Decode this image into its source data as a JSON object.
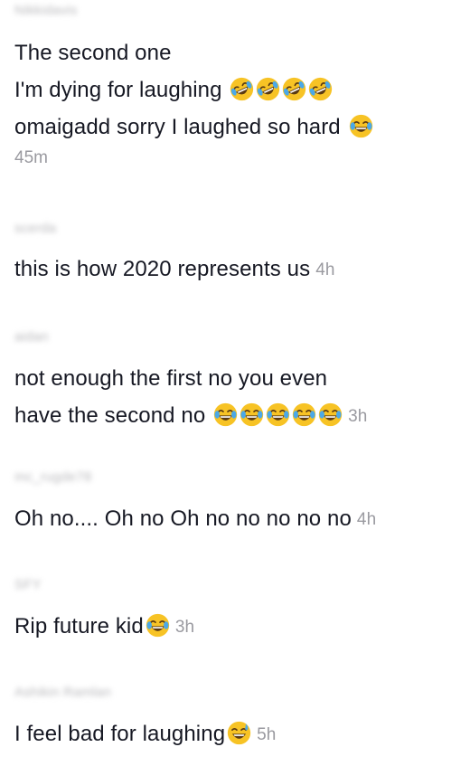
{
  "comments": [
    {
      "username": "Nikkidavis",
      "lines": [
        "The second one",
        "I'm dying for laughing",
        "omaigadd sorry I laughed so hard"
      ],
      "timestamp": "45m",
      "emoji": [
        "rolling-on-floor-laughing-icon",
        "face-with-tears-of-joy-icon"
      ]
    },
    {
      "username": "scerda",
      "lines": [
        "this is how 2020 represents us"
      ],
      "timestamp": "4h"
    },
    {
      "username": "aidan",
      "lines": [
        "not enough the first no you even",
        "have the second no"
      ],
      "timestamp": "3h",
      "emoji": [
        "face-with-tears-of-joy-icon"
      ]
    },
    {
      "username": "mc_rugde78",
      "lines": [
        "Oh no.... Oh no Oh no no no no no"
      ],
      "timestamp": "4h"
    },
    {
      "username": "SFY",
      "lines": [
        "Rip future kid"
      ],
      "timestamp": "3h",
      "emoji": [
        "face-with-tears-of-joy-icon"
      ]
    },
    {
      "username": "Ashikin Ramlan",
      "lines": [
        "I feel bad for laughing"
      ],
      "timestamp": "5h",
      "emoji": [
        "grinning-face-with-sweat-icon"
      ]
    }
  ]
}
